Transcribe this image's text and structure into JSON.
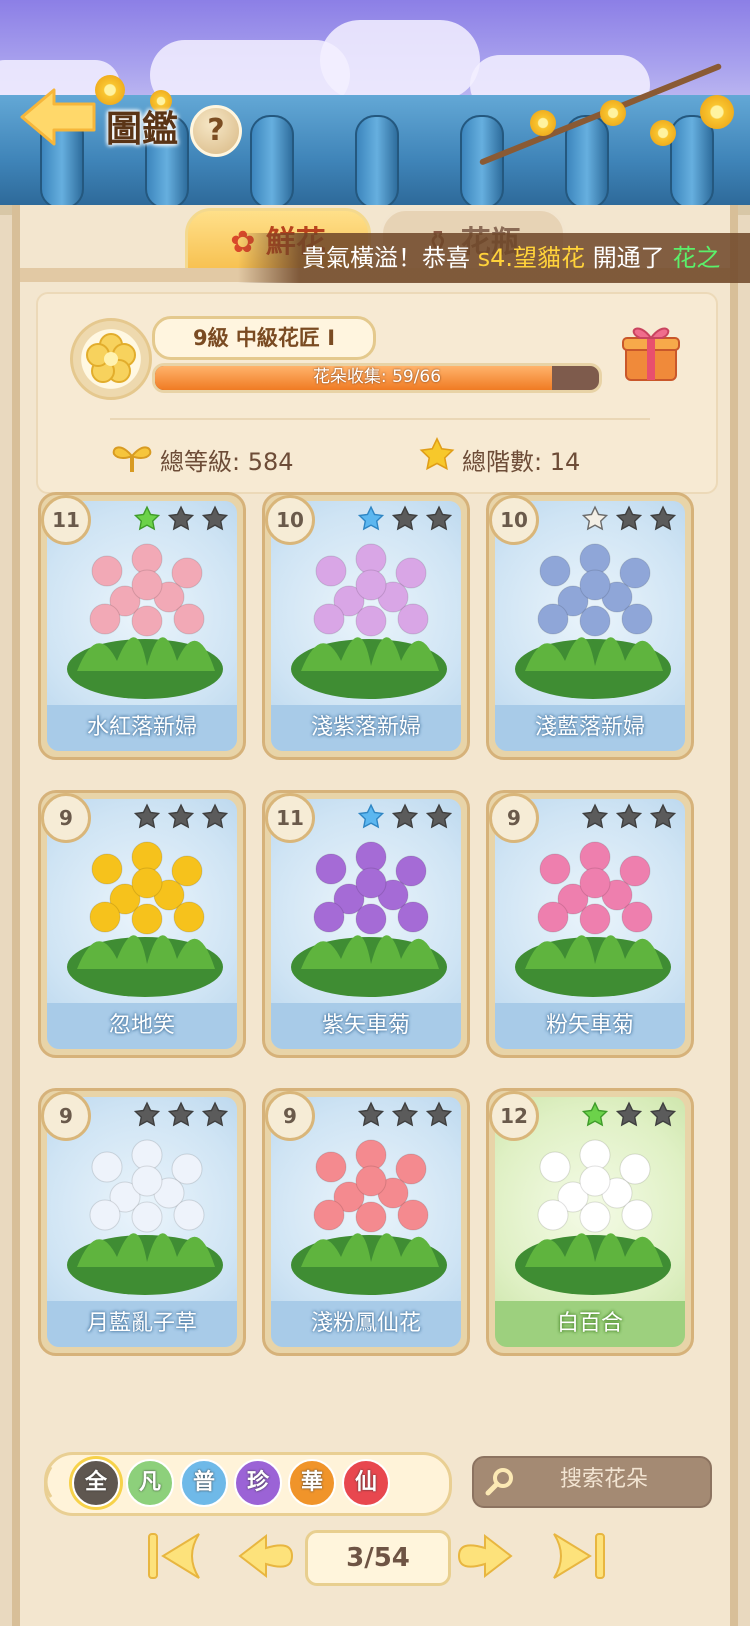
{
  "header": {
    "title": "圖鑑",
    "help_label": "?"
  },
  "tabs": [
    {
      "label": "鮮花"
    },
    {
      "label": "花瓶"
    }
  ],
  "ticker": {
    "prefix": "貴氣橫溢！恭喜",
    "user": "s4.望貓花",
    "middle": "開通了",
    "item": "花之"
  },
  "profile": {
    "level_badge": "9級  中級花匠 I",
    "collection_label": "花朵收集: 59/66",
    "collection_progress": 0.894,
    "total_level_label": "總等級: 584",
    "total_stars_label": "總階數: 14"
  },
  "flowers": [
    {
      "name": "水紅落新婦",
      "level": "11",
      "stars": [
        "green",
        "gray",
        "gray"
      ],
      "theme": "blue",
      "color": "#f2a9b6"
    },
    {
      "name": "淺紫落新婦",
      "level": "10",
      "stars": [
        "blue",
        "gray",
        "gray"
      ],
      "theme": "blue",
      "color": "#d9a6e6"
    },
    {
      "name": "淺藍落新婦",
      "level": "10",
      "stars": [
        "outline",
        "gray",
        "gray"
      ],
      "theme": "blue",
      "color": "#8fa6d8"
    },
    {
      "name": "忽地笑",
      "level": "9",
      "stars": [
        "gray",
        "gray",
        "gray"
      ],
      "theme": "blue",
      "color": "#f6c21c"
    },
    {
      "name": "紫矢車菊",
      "level": "11",
      "stars": [
        "blue",
        "gray",
        "gray"
      ],
      "theme": "blue",
      "color": "#a56bd6"
    },
    {
      "name": "粉矢車菊",
      "level": "9",
      "stars": [
        "gray",
        "gray",
        "gray"
      ],
      "theme": "blue",
      "color": "#ee7fae"
    },
    {
      "name": "月藍亂子草",
      "level": "9",
      "stars": [
        "gray",
        "gray",
        "gray"
      ],
      "theme": "blue",
      "color": "#eef3fb"
    },
    {
      "name": "淺粉鳳仙花",
      "level": "9",
      "stars": [
        "gray",
        "gray",
        "gray"
      ],
      "theme": "blue",
      "color": "#f48a8f"
    },
    {
      "name": "白百合",
      "level": "12",
      "stars": [
        "green",
        "gray",
        "gray"
      ],
      "theme": "green",
      "color": "#ffffff"
    }
  ],
  "filters": [
    {
      "label": "全",
      "color": "#5f5750"
    },
    {
      "label": "凡",
      "color": "#8dd07b"
    },
    {
      "label": "普",
      "color": "#6fb9e8"
    },
    {
      "label": "珍",
      "color": "#9b63d6"
    },
    {
      "label": "華",
      "color": "#f0942a"
    },
    {
      "label": "仙",
      "color": "#e8474f"
    }
  ],
  "search": {
    "placeholder": "搜索花朵"
  },
  "pagination": {
    "label": "3/54"
  }
}
